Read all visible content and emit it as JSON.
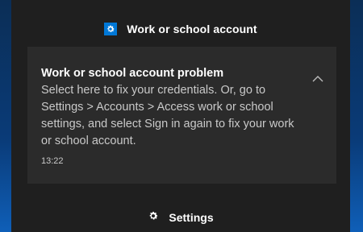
{
  "group": {
    "title": "Work or school account",
    "icon": "gear-icon",
    "icon_bg": "#0078d7"
  },
  "notification": {
    "title": "Work or school account problem",
    "body": "Select here to fix your credentials.  Or, go to Settings > Accounts > Access work or school settings, and select Sign in again to fix your work or school account.",
    "time": "13:22",
    "collapse_icon": "chevron-up-icon"
  },
  "footer": {
    "settings_label": "Settings",
    "settings_icon": "gear-icon"
  },
  "colors": {
    "panel_bg": "#1f1f1f",
    "card_bg": "#2b2b2b",
    "accent": "#0078d7"
  }
}
